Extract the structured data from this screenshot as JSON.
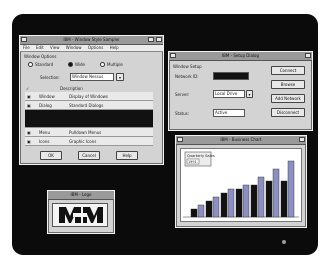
{
  "main_dialog": {
    "title": "IBM - Window Style Sampler",
    "menu": [
      "File",
      "Edit",
      "View",
      "Window",
      "Options",
      "Help"
    ],
    "group_label": "Window Options",
    "radio_labels": [
      "Standard",
      "Wide",
      "Multiple"
    ],
    "selected_radio": "Wide",
    "field_label": "Selection:",
    "field_value": "Window Nessus",
    "list_header": "Description",
    "rows": [
      {
        "col1": "Window",
        "col2": "Display of Windows"
      },
      {
        "col1": "Dialog",
        "col2": "Standard Dialogs"
      },
      {
        "col1": "",
        "col2": ""
      },
      {
        "col1": "Menu",
        "col2": "Pulldown Menus"
      },
      {
        "col1": "Icons",
        "col2": "Graphic Icons"
      }
    ],
    "buttons": [
      "OK",
      "Cancel",
      "Help"
    ]
  },
  "setup_dialog": {
    "title": "IBM - Setup Dialog",
    "labels": [
      "Window Setup",
      "Network ID:",
      "Server:",
      "Status:"
    ],
    "values": [
      "",
      "",
      "Local Drive",
      "Active"
    ],
    "buttons": [
      "Connect",
      "Browse",
      "Add Network",
      "Disconnect"
    ]
  },
  "chart_window": {
    "title": "IBM - Business Chart",
    "legend": [
      "Quarterly Sales",
      "1991"
    ]
  },
  "chart_data": {
    "type": "bar",
    "categories": [
      "1",
      "2",
      "3",
      "4",
      "5",
      "6",
      "7"
    ],
    "series": [
      {
        "values": [
          1,
          2,
          3,
          3.5,
          4,
          4.5,
          4.5
        ]
      },
      {
        "values": [
          1.5,
          2.5,
          3.5,
          4,
          5,
          6,
          7
        ]
      }
    ],
    "title": "",
    "xlabel": "",
    "ylabel": "",
    "ylim": [
      0,
      7.5
    ],
    "grid": false,
    "legend_position": "top-left",
    "colors": [
      "#111111",
      "#8c8fc0"
    ]
  },
  "logo_window": {
    "title": "IBM - Logo",
    "logo_alt": "logo-graphic"
  },
  "colors": {
    "desktop": "#0b0b0b",
    "window_face": "#d3d3d3",
    "title_bar": "#9a9a9a",
    "bar_light": "#8c8fc0",
    "bar_dark": "#111111"
  }
}
